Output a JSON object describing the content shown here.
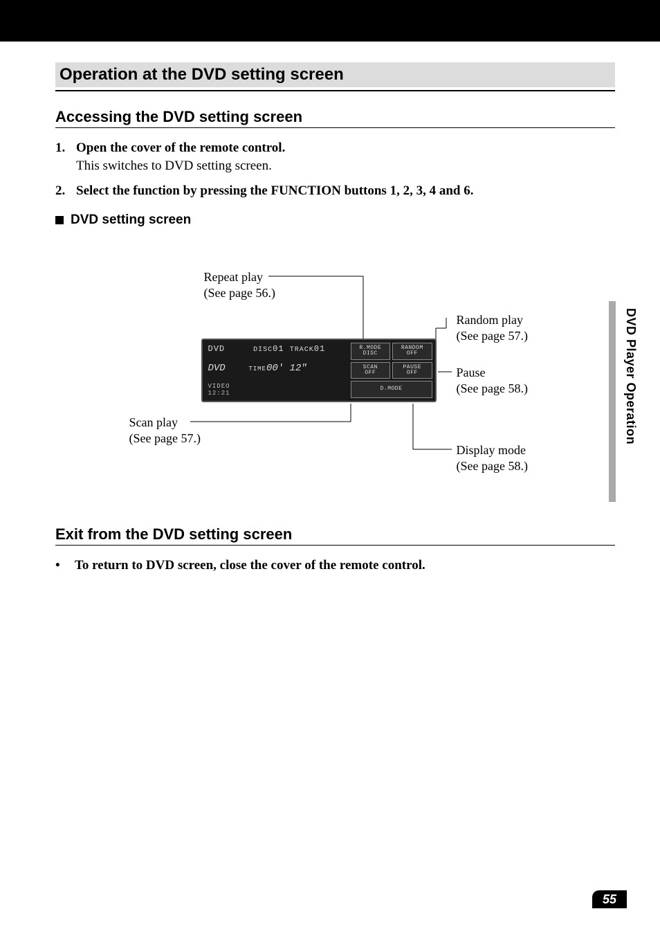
{
  "header_bar": "",
  "section_title": "Operation at the DVD setting screen",
  "sub1": "Accessing the DVD setting screen",
  "steps": [
    {
      "num": "1.",
      "title": "Open the cover of the remote control.",
      "note": "This switches to DVD setting screen."
    },
    {
      "num": "2.",
      "title": "Select the function by pressing the FUNCTION buttons 1, 2, 3, 4 and 6.",
      "note": ""
    }
  ],
  "dvd_setting_label": "DVD setting screen",
  "callouts": {
    "repeat": {
      "l1": "Repeat play",
      "l2": "(See page 56.)"
    },
    "random": {
      "l1": "Random play",
      "l2": "(See page 57.)"
    },
    "pause": {
      "l1": "Pause",
      "l2": "(See page 58.)"
    },
    "scan": {
      "l1": "Scan play",
      "l2": "(See page 57.)"
    },
    "display": {
      "l1": "Display mode",
      "l2": "(See page 58.)"
    }
  },
  "device": {
    "row1_left": "DVD",
    "row1_mid_a": "DISC",
    "row1_mid_b": "01",
    "row1_mid_c": "TRACK",
    "row1_mid_d": "01",
    "row2_logo": "DVD",
    "row2_time_lbl": "TIME",
    "row2_time_val": "00' 12\"",
    "row3a": "VIDEO",
    "row3b": "12:21",
    "btns": {
      "rmode_a": "R.MODE",
      "rmode_b": "DISC",
      "random_a": "RANDOM",
      "random_b": "OFF",
      "scan_a": "SCAN",
      "scan_b": "OFF",
      "pause_a": "PAUSE",
      "pause_b": "OFF",
      "dmode": "D.MODE"
    }
  },
  "sub2": "Exit from the DVD setting screen",
  "exit_bullet": "To return to DVD screen, close the cover of the remote control.",
  "side_tab": "DVD Player Operation",
  "page_number": "55"
}
